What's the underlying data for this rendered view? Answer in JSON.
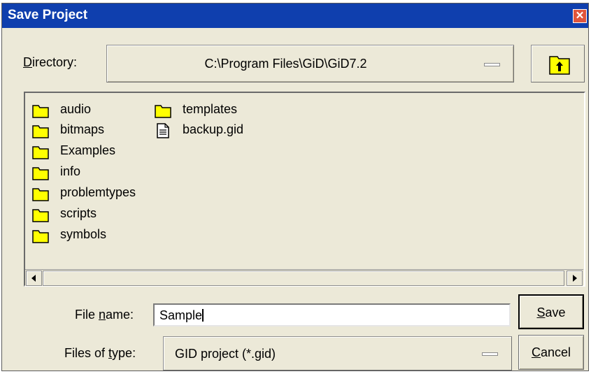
{
  "window": {
    "title": "Save Project"
  },
  "directory": {
    "label": "Directory:",
    "value": "C:\\Program Files\\GiD\\GiD7.2"
  },
  "files": [
    {
      "name": "audio",
      "type": "folder"
    },
    {
      "name": "bitmaps",
      "type": "folder"
    },
    {
      "name": "Examples",
      "type": "folder"
    },
    {
      "name": "info",
      "type": "folder"
    },
    {
      "name": "problemtypes",
      "type": "folder"
    },
    {
      "name": "scripts",
      "type": "folder"
    },
    {
      "name": "symbols",
      "type": "folder"
    },
    {
      "name": "templates",
      "type": "folder"
    },
    {
      "name": "backup.gid",
      "type": "file"
    }
  ],
  "file_name": {
    "label": "File name:",
    "value": "Sample"
  },
  "file_type": {
    "label": "Files of type:",
    "value": "GID project (*.gid)"
  },
  "buttons": {
    "save": "Save",
    "cancel": "Cancel"
  },
  "colors": {
    "titlebar": "#0f3fae",
    "window": "#ece9d8",
    "folder": "#ffff00"
  }
}
